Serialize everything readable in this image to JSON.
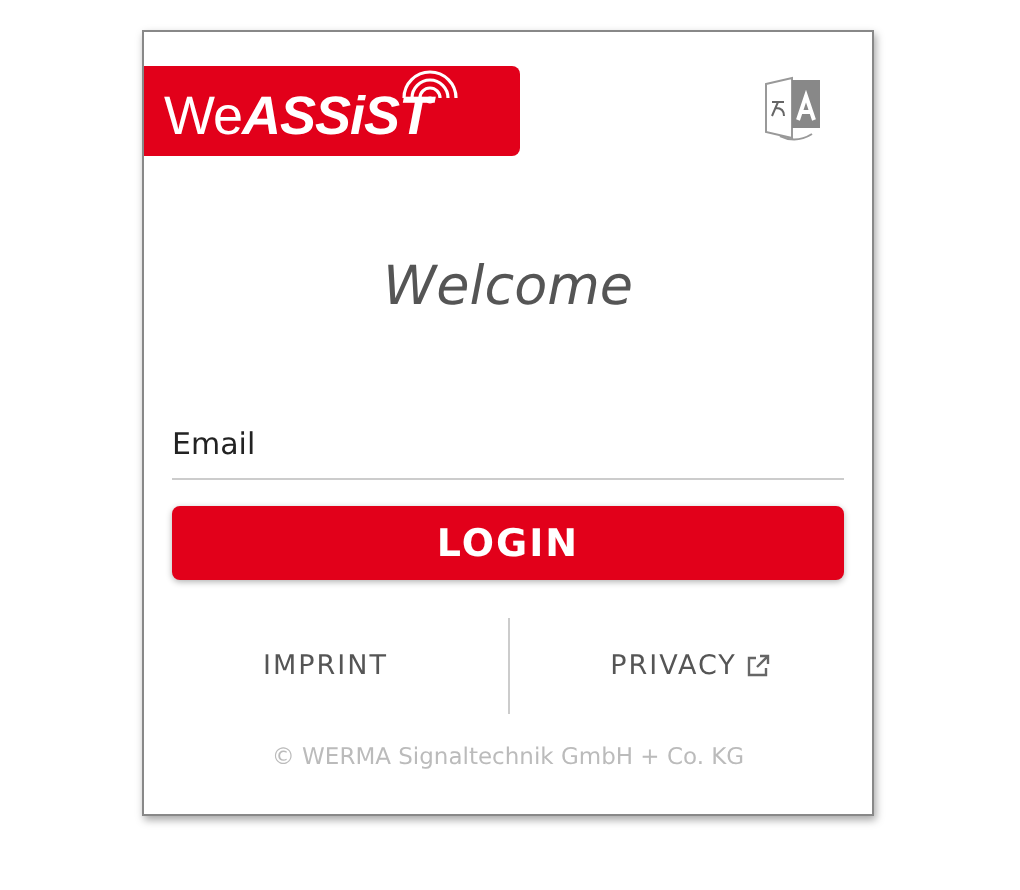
{
  "logo": {
    "text": "We**ASSiST**"
  },
  "heading": "Welcome",
  "email": {
    "placeholder": "Email"
  },
  "login_button": "LOGIN",
  "links": [
    {
      "label": "IMPRINT",
      "external": false
    },
    {
      "label": "PRIVACY",
      "external": true
    }
  ],
  "footer": "© WERMA Signaltechnik GmbH + Co. KG"
}
